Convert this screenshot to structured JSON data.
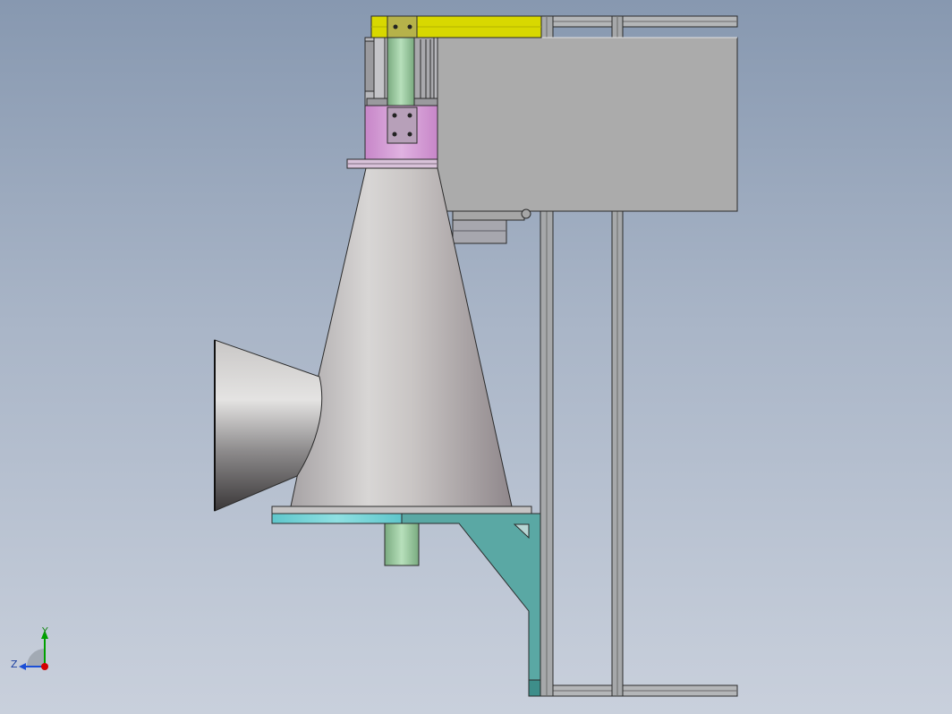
{
  "viewport": {
    "background_top": "#8798b0",
    "background_bottom": "#c9d0dc"
  },
  "colors": {
    "frame": "#9aa0a6",
    "panel": "#ababab",
    "yellow_beam": "#d8d800",
    "green_shaft": "#94c79a",
    "pink_housing": "#d79ed8",
    "cone": "#c8c4c4",
    "teal_bracket": "#5aa8a4",
    "cyan_plate": "#6fcfd3",
    "axis_x": "#d40000",
    "axis_y": "#00a000",
    "axis_z": "#1c4fd6"
  },
  "triad": {
    "x_label": "",
    "y_label": "Y",
    "z_label": "Z",
    "x_icon": "axis-x-arrow-icon",
    "y_icon": "axis-y-arrow-icon",
    "z_icon": "axis-z-arrow-icon"
  }
}
